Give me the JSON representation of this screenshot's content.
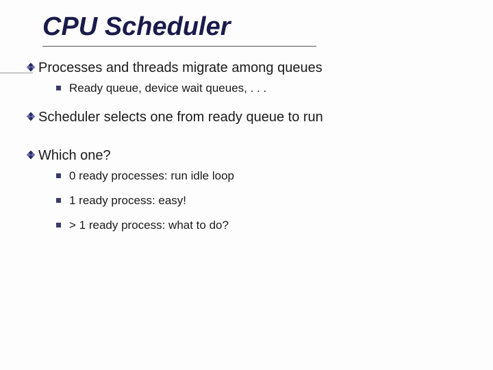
{
  "title": "CPU Scheduler",
  "bullets": [
    {
      "text": "Processes and threads migrate among queues",
      "subs": [
        "Ready queue, device wait queues, . . ."
      ]
    },
    {
      "text": "Scheduler selects one from ready queue to run",
      "subs": []
    },
    {
      "text": "Which one?",
      "subs": [
        "0 ready processes: run idle loop",
        "1 ready process: easy!",
        "> 1 ready process: what to do?"
      ]
    }
  ]
}
